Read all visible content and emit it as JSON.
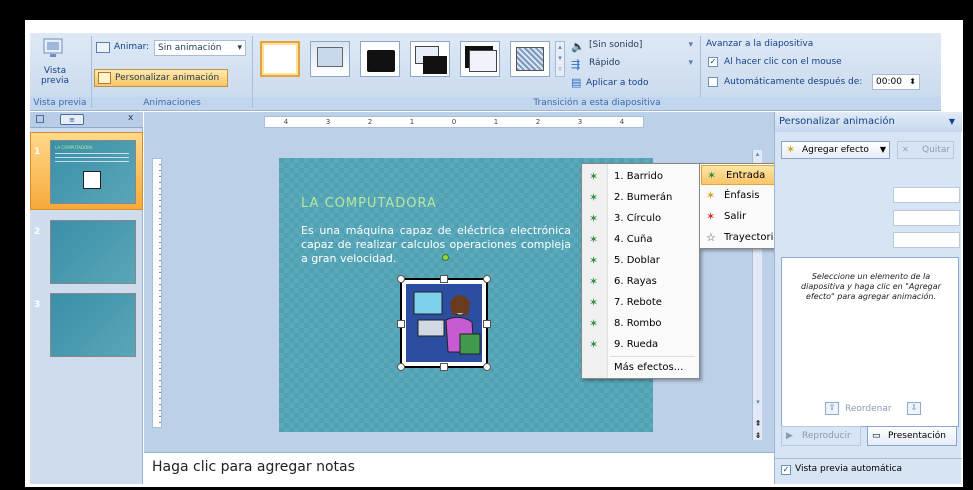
{
  "ribbon": {
    "preview_label": "Vista previa",
    "preview_group": "Vista previa",
    "animate_label": "Animar:",
    "animate_value": "Sin animación",
    "custom_anim_button": "Personalizar animación",
    "anim_group": "Animaciones",
    "sound_value": "[Sin sonido]",
    "speed_value": "Rápido",
    "apply_all": "Aplicar a todo",
    "transition_group": "Transición a esta diapositiva",
    "advance_title": "Avanzar a la diapositiva",
    "on_click": "Al hacer clic con el mouse",
    "auto_after": "Automáticamente después de:",
    "auto_time": "00:00"
  },
  "thumbs": {
    "close": "x",
    "slide_numbers": [
      "1",
      "2",
      "3"
    ],
    "thumb_title": "LA COMPUTADORA"
  },
  "ruler": {
    "numbers": [
      "4",
      "3",
      "2",
      "1",
      "0",
      "1",
      "2",
      "3",
      "4"
    ]
  },
  "slide": {
    "title": "LA COMPUTADORA",
    "body": "Es una máquina capaz de eléctrica electrónica capaz de realizar calculos operaciones compleja a gran velocidad."
  },
  "effects_menu": {
    "items": [
      "1. Barrido",
      "2. Bumerán",
      "3. Círculo",
      "4. Cuña",
      "5. Doblar",
      "6. Rayas",
      "7. Rebote",
      "8. Rombo",
      "9. Rueda"
    ],
    "more": "Más efectos..."
  },
  "submenu": {
    "items": [
      "Entrada",
      "Énfasis",
      "Salir",
      "Trayectoria de la animación"
    ]
  },
  "taskpane": {
    "title": "Personalizar animación",
    "add_effect": "Agregar efecto",
    "remove": "Quitar",
    "hint": "Seleccione un elemento de la diapositiva y haga clic en \"Agregar efecto\" para agregar animación.",
    "reorder": "Reordenar",
    "play": "Reproducir",
    "slideshow": "Presentación",
    "auto_preview": "Vista previa automática"
  },
  "notes": {
    "placeholder": "Haga clic para agregar notas"
  },
  "colors": {
    "slide_bg": "#4fa1b4",
    "accent_orange": "#f9c56a",
    "title_green": "#b8e89a"
  }
}
